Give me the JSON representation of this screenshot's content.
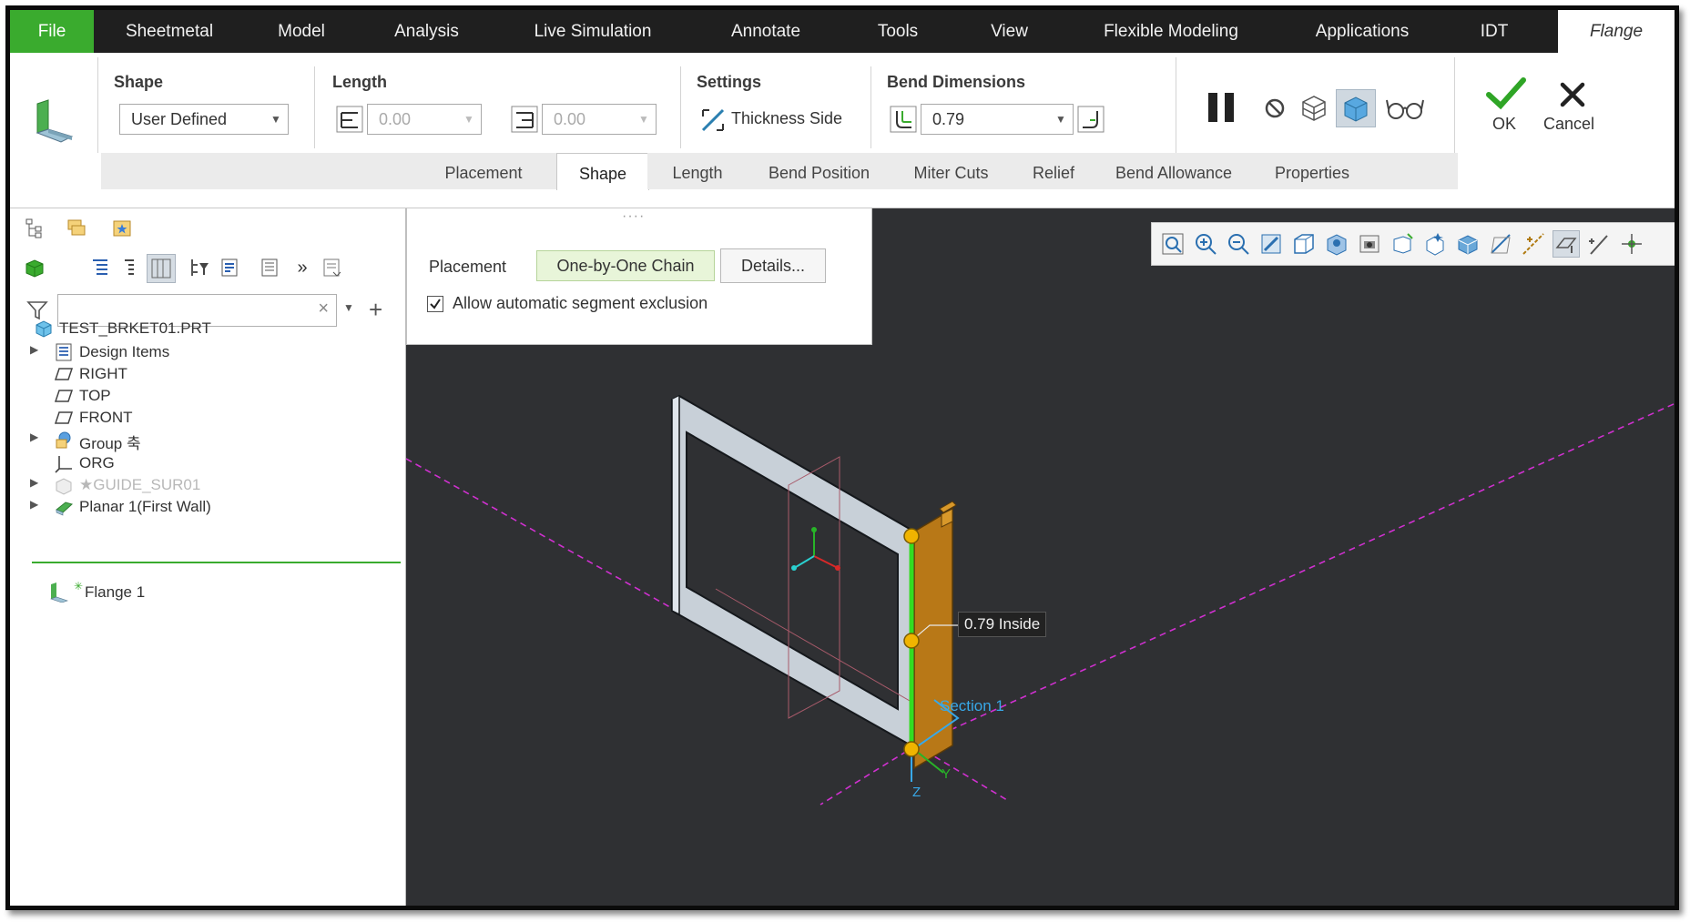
{
  "ribbon_tabs": [
    "File",
    "Sheetmetal",
    "Model",
    "Analysis",
    "Live Simulation",
    "Annotate",
    "Tools",
    "View",
    "Flexible Modeling",
    "Applications",
    "IDT",
    "Flange"
  ],
  "groups": {
    "shape": {
      "label": "Shape",
      "value": "User Defined"
    },
    "length": {
      "label": "Length",
      "value1": "0.00",
      "value2": "0.00"
    },
    "settings": {
      "label": "Settings",
      "thickness_side": "Thickness Side"
    },
    "bend_dimensions": {
      "label": "Bend Dimensions",
      "value": "0.79"
    }
  },
  "actions": {
    "ok": "OK",
    "cancel": "Cancel"
  },
  "subtabs": [
    "Placement",
    "Shape",
    "Length",
    "Bend Position",
    "Miter Cuts",
    "Relief",
    "Bend Allowance",
    "Properties"
  ],
  "placement_panel": {
    "grip": "····",
    "label": "Placement",
    "chain": "One-by-One Chain",
    "details": "Details...",
    "checkbox_label": "Allow automatic segment exclusion",
    "checkbox_checked": true
  },
  "search": {
    "value": ""
  },
  "tree": [
    {
      "label": "TEST_BRKET01.PRT",
      "icon": "part-icon",
      "expandable": false
    },
    {
      "label": "Design Items",
      "icon": "design-items-icon",
      "expandable": true
    },
    {
      "label": "RIGHT",
      "icon": "datum-plane-icon",
      "expandable": false
    },
    {
      "label": "TOP",
      "icon": "datum-plane-icon",
      "expandable": false
    },
    {
      "label": "FRONT",
      "icon": "datum-plane-icon",
      "expandable": false
    },
    {
      "label": "Group 축",
      "icon": "group-icon",
      "expandable": true
    },
    {
      "label": "ORG",
      "icon": "csys-icon",
      "expandable": false
    },
    {
      "label": "★GUIDE_SUR01",
      "icon": "surface-icon",
      "expandable": true,
      "dim": true
    },
    {
      "label": "Planar 1(First Wall)",
      "icon": "planar-wall-icon",
      "expandable": true
    }
  ],
  "insert_node": {
    "label": "Flange 1",
    "icon": "flange-icon"
  },
  "viewport": {
    "dimension_tag": "0.79 Inside",
    "section_label": "Section 1",
    "axis_y": "Y",
    "axis_z": "Z"
  },
  "colors": {
    "file_tab": "#3aab2e",
    "tabbar": "#1f1f1f",
    "viewport_bg": "#2f3033",
    "flange": "#b87817",
    "edge_highlight": "#33dd22",
    "handle": "#f0b400"
  }
}
